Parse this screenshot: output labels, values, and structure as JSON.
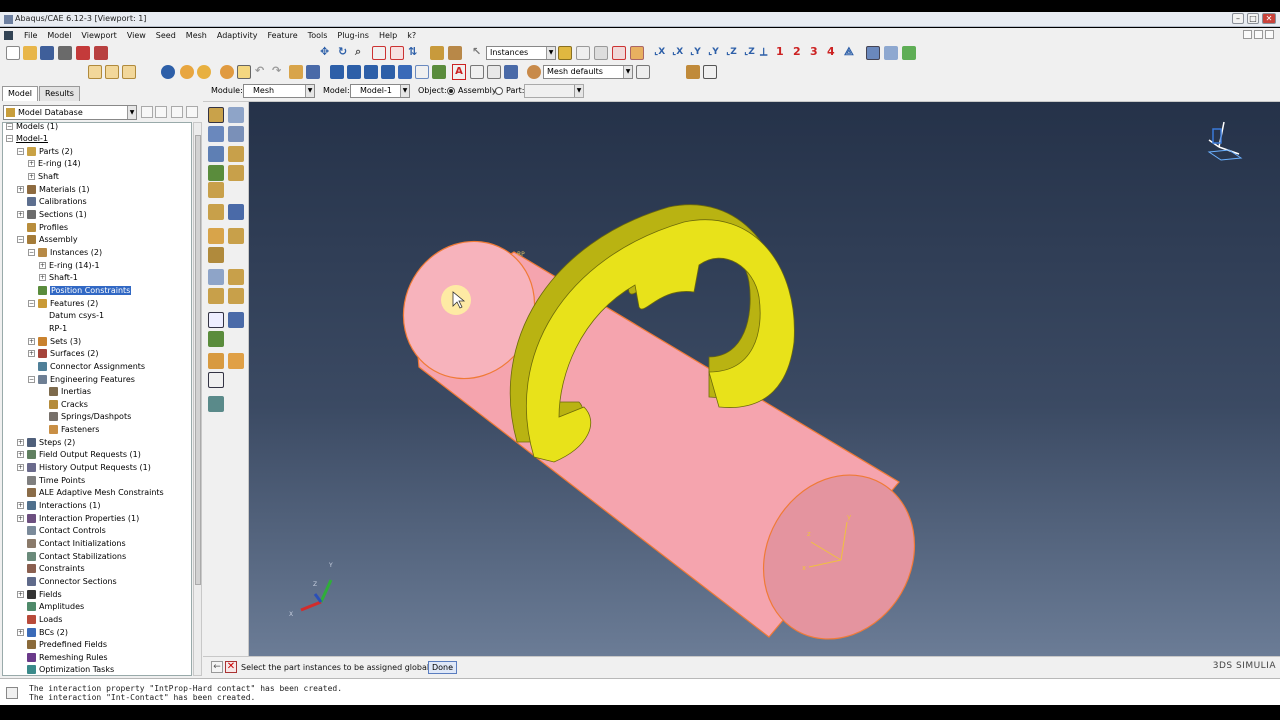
{
  "window": {
    "title": "Abaqus/CAE 6.12-3 [Viewport: 1]",
    "buttons": [
      "–",
      "□",
      "✕"
    ]
  },
  "menu": [
    "File",
    "Model",
    "Viewport",
    "View",
    "Seed",
    "Mesh",
    "Adaptivity",
    "Feature",
    "Tools",
    "Plug-ins",
    "Help",
    "k?"
  ],
  "toolbar": {
    "selection_filter": "Instances",
    "view_numbers": [
      "1",
      "2",
      "3",
      "4"
    ],
    "render_style": "Mesh defaults"
  },
  "context": {
    "module_label": "Module:",
    "module_value": "Mesh",
    "model_label": "Model:",
    "model_value": "Model-1",
    "object_label": "Object:",
    "object_assembly": "Assembly",
    "object_part": "Part:",
    "part_value": ""
  },
  "panel": {
    "tabs": [
      "Model",
      "Results"
    ],
    "database": "Model Database"
  },
  "tree": [
    {
      "label": "Models (1)",
      "level": 0,
      "exp": "-"
    },
    {
      "label": "Model-1",
      "level": 0,
      "exp": "-",
      "underline": true
    },
    {
      "label": "Parts (2)",
      "level": 1,
      "exp": "-",
      "icon": "#c9a245"
    },
    {
      "label": "E-ring (14)",
      "level": 2,
      "exp": "+"
    },
    {
      "label": "Shaft",
      "level": 2,
      "exp": "+"
    },
    {
      "label": "Materials (1)",
      "level": 1,
      "exp": "+",
      "icon": "#8d6a3f"
    },
    {
      "label": "Calibrations",
      "level": 1,
      "exp": "",
      "icon": "#5d6f8f"
    },
    {
      "label": "Sections (1)",
      "level": 1,
      "exp": "+",
      "icon": "#6b6b6b"
    },
    {
      "label": "Profiles",
      "level": 1,
      "exp": "",
      "icon": "#b88d3c"
    },
    {
      "label": "Assembly",
      "level": 1,
      "exp": "-",
      "icon": "#a47b38"
    },
    {
      "label": "Instances (2)",
      "level": 2,
      "exp": "-",
      "icon": "#b78a46"
    },
    {
      "label": "E-ring (14)-1",
      "level": 3,
      "exp": "+"
    },
    {
      "label": "Shaft-1",
      "level": 3,
      "exp": "+"
    },
    {
      "label": "Position Constraints",
      "level": 2,
      "exp": "",
      "icon": "#5a8c3c",
      "selected": true
    },
    {
      "label": "Features (2)",
      "level": 2,
      "exp": "-",
      "icon": "#c99a36"
    },
    {
      "label": "Datum csys-1",
      "level": 3,
      "exp": ""
    },
    {
      "label": "RP-1",
      "level": 3,
      "exp": ""
    },
    {
      "label": "Sets (3)",
      "level": 2,
      "exp": "+",
      "icon": "#c9822f"
    },
    {
      "label": "Surfaces (2)",
      "level": 2,
      "exp": "+",
      "icon": "#a5443a"
    },
    {
      "label": "Connector Assignments",
      "level": 2,
      "exp": "",
      "icon": "#4f7f98"
    },
    {
      "label": "Engineering Features",
      "level": 2,
      "exp": "-",
      "icon": "#6e7f94"
    },
    {
      "label": "Inertias",
      "level": 3,
      "exp": "",
      "icon": "#7d6a4c"
    },
    {
      "label": "Cracks",
      "level": 3,
      "exp": "",
      "icon": "#b48b3b"
    },
    {
      "label": "Springs/Dashpots",
      "level": 3,
      "exp": "",
      "icon": "#77706a"
    },
    {
      "label": "Fasteners",
      "level": 3,
      "exp": "",
      "icon": "#c98f45"
    },
    {
      "label": "Steps (2)",
      "level": 1,
      "exp": "+",
      "icon": "#4f5f7a"
    },
    {
      "label": "Field Output Requests (1)",
      "level": 1,
      "exp": "+",
      "icon": "#5f7f5f"
    },
    {
      "label": "History Output Requests (1)",
      "level": 1,
      "exp": "+",
      "icon": "#6a6a8c"
    },
    {
      "label": "Time Points",
      "level": 1,
      "exp": "",
      "icon": "#7f7f7f"
    },
    {
      "label": "ALE Adaptive Mesh Constraints",
      "level": 1,
      "exp": "",
      "icon": "#8a6c48"
    },
    {
      "label": "Interactions (1)",
      "level": 1,
      "exp": "+",
      "icon": "#4f6f8c"
    },
    {
      "label": "Interaction Properties (1)",
      "level": 1,
      "exp": "+",
      "icon": "#6c4f7f"
    },
    {
      "label": "Contact Controls",
      "level": 1,
      "exp": "",
      "icon": "#7a8a9a"
    },
    {
      "label": "Contact Initializations",
      "level": 1,
      "exp": "",
      "icon": "#8a7a6a"
    },
    {
      "label": "Contact Stabilizations",
      "level": 1,
      "exp": "",
      "icon": "#6a8a7a"
    },
    {
      "label": "Constraints",
      "level": 1,
      "exp": "",
      "icon": "#8a5f4f"
    },
    {
      "label": "Connector Sections",
      "level": 1,
      "exp": "",
      "icon": "#5f6a8a"
    },
    {
      "label": "Fields",
      "level": 1,
      "exp": "+",
      "icon": "#333333"
    },
    {
      "label": "Amplitudes",
      "level": 1,
      "exp": "",
      "icon": "#4f8a6a"
    },
    {
      "label": "Loads",
      "level": 1,
      "exp": "",
      "icon": "#b84a3a"
    },
    {
      "label": "BCs (2)",
      "level": 1,
      "exp": "+",
      "icon": "#3a6ab8"
    },
    {
      "label": "Predefined Fields",
      "level": 1,
      "exp": "",
      "icon": "#8a6a3a"
    },
    {
      "label": "Remeshing Rules",
      "level": 1,
      "exp": "",
      "icon": "#6a3a8a"
    },
    {
      "label": "Optimization Tasks",
      "level": 1,
      "exp": "",
      "icon": "#3a8a8a"
    }
  ],
  "viewport": {
    "triad_labels": [
      "X",
      "Y",
      "Z"
    ],
    "part_csys_labels": [
      "x",
      "y",
      "z"
    ],
    "marker_label": "RP",
    "colors": {
      "shaft": "#f5a4ae",
      "shaft_edge": "#f07a36",
      "ring": "#e8e21a",
      "ring_shadow": "#b9b312",
      "cursor_highlight": "#fff3a0"
    }
  },
  "prompt": {
    "back": "←",
    "cancel": "✕",
    "text": "Select the part instances to be assigned global seeds",
    "done": "Done",
    "brand": "3DS SIMULIA"
  },
  "messages": [
    "The interaction property \"IntProp-Hard contact\" has been created.",
    "The interaction \"Int-Contact\" has been created."
  ]
}
